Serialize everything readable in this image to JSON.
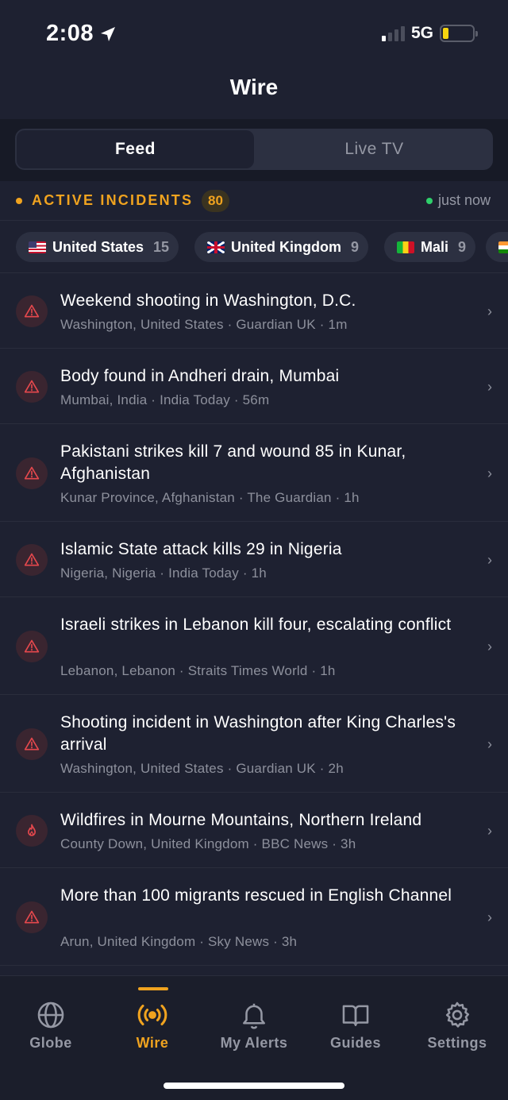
{
  "status": {
    "time": "2:08",
    "network": "5G"
  },
  "nav": {
    "title": "Wire"
  },
  "segments": {
    "feed": "Feed",
    "live_tv": "Live TV",
    "selected": "Feed"
  },
  "incidents": {
    "label": "ACTIVE INCIDENTS",
    "count": "80",
    "updated": "just now"
  },
  "chips": [
    {
      "country": "United States",
      "count": "15",
      "flag": "us-flag"
    },
    {
      "country": "United Kingdom",
      "count": "9",
      "flag": "uk-flag"
    },
    {
      "country": "Mali",
      "count": "9",
      "flag": "mali-flag"
    },
    {
      "country": "",
      "count": "",
      "flag": "india-flag"
    }
  ],
  "feed": [
    {
      "title": "Weekend shooting in Washington, D.C.",
      "meta": "Washington, United States · Guardian UK · 1m",
      "icon": "warning-icon"
    },
    {
      "title": "Body found in Andheri drain, Mumbai",
      "meta": "Mumbai, India · India Today · 56m",
      "icon": "warning-icon"
    },
    {
      "title": "Pakistani strikes kill 7 and wound 85 in Kunar, Afghanistan",
      "meta": "Kunar Province, Afghanistan · The Guardian · 1h",
      "icon": "warning-icon"
    },
    {
      "title": "Islamic State attack kills 29 in Nigeria",
      "meta": "Nigeria, Nigeria · India Today · 1h",
      "icon": "warning-icon"
    },
    {
      "title": "Israeli strikes in Lebanon kill four, escalating conflict",
      "meta": "Lebanon, Lebanon · Straits Times World · 1h",
      "icon": "warning-icon"
    },
    {
      "title": "Shooting incident in Washington after King Charles's arrival",
      "meta": "Washington, United States · Guardian UK · 2h",
      "icon": "warning-icon"
    },
    {
      "title": "Wildfires in Mourne Mountains, Northern Ireland",
      "meta": "County Down, United Kingdom · BBC News · 3h",
      "icon": "fire-icon"
    },
    {
      "title": "More than 100 migrants rescued in English Channel",
      "meta": "Arun, United Kingdom · Sky News · 3h",
      "icon": "warning-icon"
    }
  ],
  "tabs": {
    "globe": "Globe",
    "wire": "Wire",
    "alerts": "My Alerts",
    "guides": "Guides",
    "settings": "Settings",
    "active": "Wire"
  },
  "colors": {
    "accent": "#f0a31f",
    "background": "#1e2131",
    "alert": "#e5484d",
    "live": "#2fcf6b"
  }
}
